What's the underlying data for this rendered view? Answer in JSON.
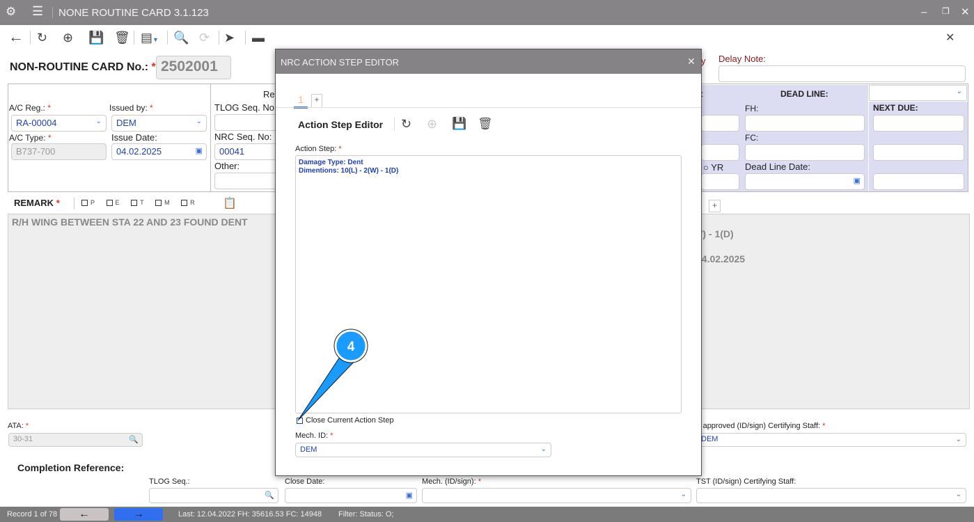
{
  "app": {
    "title": "NONE ROUTINE CARD 3.1.123"
  },
  "header": {
    "card_no_label": "NON-ROUTINE CARD No.:",
    "card_no": "2502001",
    "req": "*"
  },
  "form": {
    "ac_reg_label": "A/C Reg.:",
    "ac_reg": "RA-00004",
    "issued_by_label": "Issued by:",
    "issued_by": "DEM",
    "ac_type_label": "A/C Type:",
    "ac_type": "B737-700",
    "issue_date_label": "Issue Date:",
    "issue_date": "04.02.2025",
    "re_label": "Re",
    "tlog_label": "TLOG Seq. No:",
    "nrc_seq_label": "NRC Seq. No:",
    "nrc_seq": "00041",
    "other_label": "Other:",
    "delay_partial": "y",
    "delay_note_label": "Delay Note:",
    "colon_partial": ":",
    "dead_line_label": "DEAD LINE:",
    "fh_label": "FH:",
    "fc_label": "FC:",
    "yr_label": "YR",
    "dead_line_date_label": "Dead Line Date:",
    "next_due_label": "NEXT DUE:"
  },
  "remark": {
    "label": "REMARK",
    "checks": [
      "P",
      "E",
      "T",
      "M",
      "R"
    ],
    "text": "R/H WING BETWEEN STA 22 AND 23 FOUND DENT",
    "partial_line1": "V) - 1(D)",
    "partial_line2": "04.02.2025"
  },
  "ata": {
    "label": "ATA:",
    "value": "30-31"
  },
  "certifying": {
    "label": "T approved (ID/sign) Certifying Staff:",
    "value": "DEM"
  },
  "completion": {
    "title": "Completion Reference:",
    "tlog_label": "TLOG Seq.:",
    "close_date_label": "Close Date:",
    "mech_label": "Mech. (ID/sign):",
    "tst_label": "TST (ID/sign) Certifying Staff:"
  },
  "statusbar": {
    "record": "Record 1 of 78",
    "last": "Last: 12.04.2022 FH: 35616.53 FC: 14948",
    "filter": "Filter: Status: O;"
  },
  "modal": {
    "title": "NRC ACTION STEP EDITOR",
    "tab": "1",
    "add_tab": "+",
    "editor_title": "Action Step Editor",
    "action_step_label": "Action Step:",
    "action_step_lines": [
      "Damage Type: Dent",
      "Dimentions: 10(L) - 2(W) - 1(D)"
    ],
    "close_step_label": "Close Current Action Step",
    "mech_id_label": "Mech. ID:",
    "mech_id": "DEM"
  },
  "callout": {
    "number": "4"
  }
}
